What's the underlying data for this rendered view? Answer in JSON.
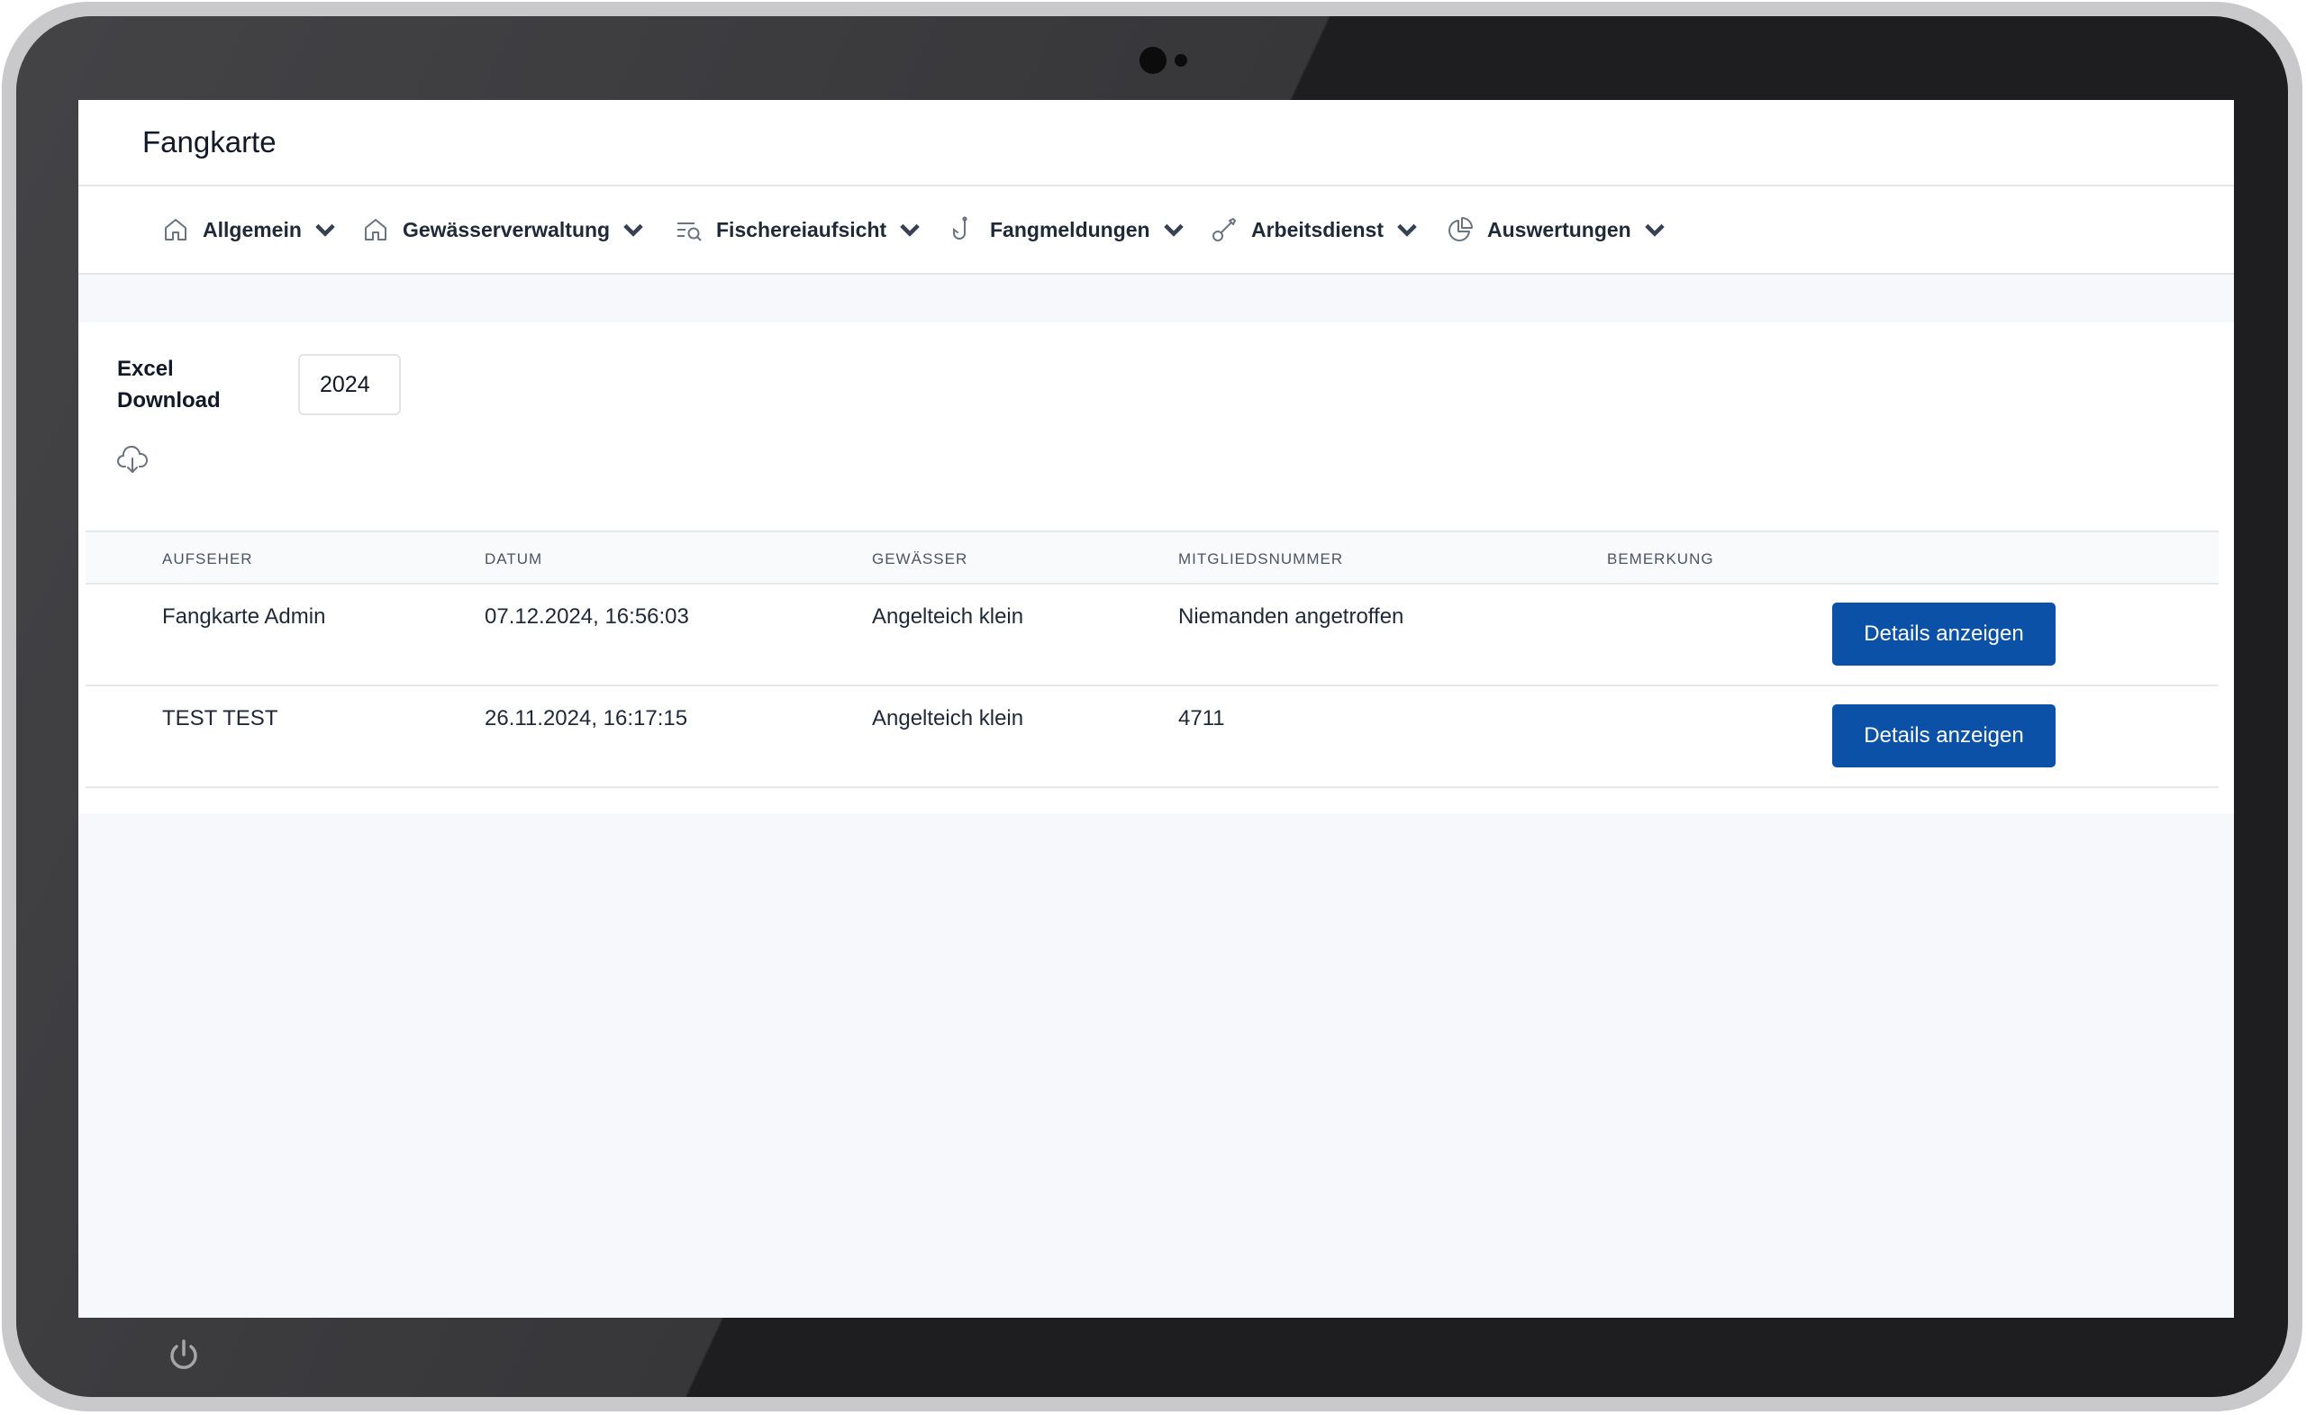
{
  "app": {
    "title": "Fangkarte"
  },
  "nav": {
    "items": [
      {
        "label": "Allgemein",
        "icon": "home-icon"
      },
      {
        "label": "Gewässerverwaltung",
        "icon": "home-icon"
      },
      {
        "label": "Fischereiaufsicht",
        "icon": "list-search-icon"
      },
      {
        "label": "Fangmeldungen",
        "icon": "fish-hook-icon"
      },
      {
        "label": "Arbeitsdienst",
        "icon": "wrench-icon"
      },
      {
        "label": "Auswertungen",
        "icon": "pie-chart-icon"
      }
    ]
  },
  "download": {
    "label": "Excel Download",
    "year": "2024",
    "icon": "cloud-download-icon"
  },
  "table": {
    "headers": [
      "AUFSEHER",
      "DATUM",
      "GEWÄSSER",
      "MITGLIEDSNUMMER",
      "BEMERKUNG"
    ],
    "rows": [
      {
        "aufseher": "Fangkarte Admin",
        "datum": "07.12.2024, 16:56:03",
        "gewaesser": "Angelteich klein",
        "mitgliedsnummer": "Niemanden angetroffen",
        "bemerkung": "",
        "button": "Details anzeigen"
      },
      {
        "aufseher": "TEST TEST",
        "datum": "26.11.2024, 16:17:15",
        "gewaesser": "Angelteich klein",
        "mitgliedsnummer": "4711",
        "bemerkung": "",
        "button": "Details anzeigen"
      }
    ]
  },
  "colors": {
    "primary": "#0b51a8",
    "bezel": "#1f1f21",
    "background": "#f7f8fb"
  }
}
